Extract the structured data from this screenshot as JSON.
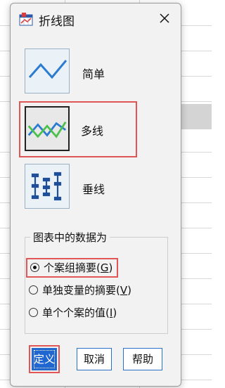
{
  "dialog": {
    "title": "折线图",
    "icons": {
      "app": "line-chart-app-icon",
      "close": "close-icon"
    }
  },
  "chart_types": [
    {
      "label": "简单",
      "icon": "simple-line-icon",
      "selected": false
    },
    {
      "label": "多线",
      "icon": "multiple-line-icon",
      "selected": true
    },
    {
      "label": "垂线",
      "icon": "drop-line-icon",
      "selected": false
    }
  ],
  "data_in_chart": {
    "legend": "图表中的数据为",
    "options": [
      {
        "label": "个案组摘要",
        "mnemonic": "G",
        "selected": true
      },
      {
        "label": "单独变量的摘要",
        "mnemonic": "V",
        "selected": false
      },
      {
        "label": "单个个案的值",
        "mnemonic": "I",
        "selected": false
      }
    ]
  },
  "buttons": {
    "define": "定义",
    "cancel": "取消",
    "help": "帮助"
  },
  "colors": {
    "accent": "#1f66d1",
    "highlight": "#e05555",
    "line_blue": "#2b7bd0",
    "line_green": "#4cc04c"
  }
}
